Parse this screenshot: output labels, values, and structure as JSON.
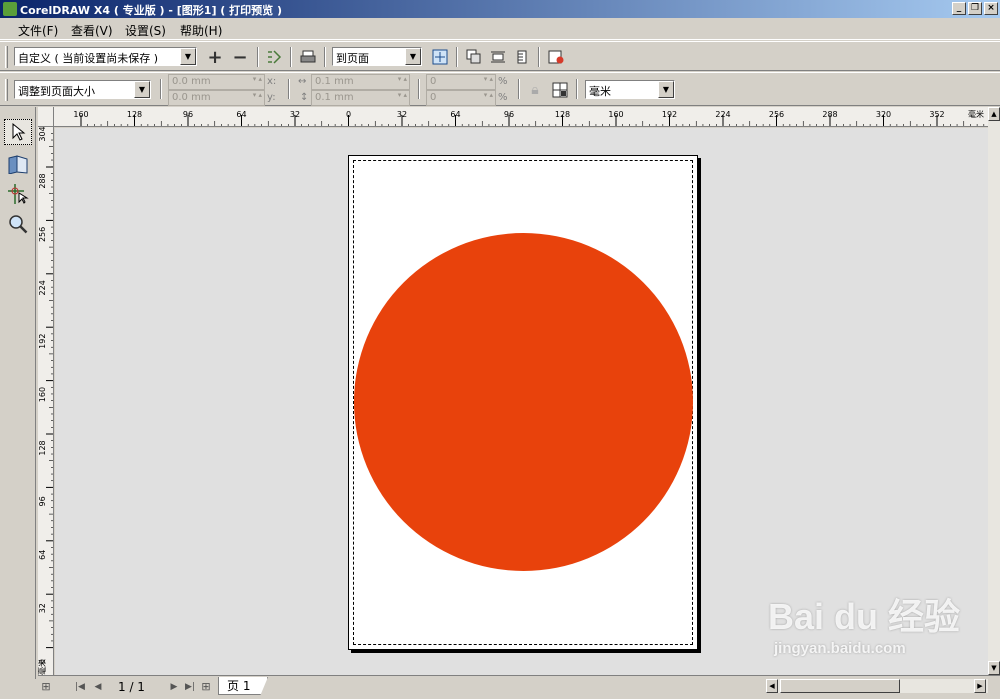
{
  "window": {
    "title": "CorelDRAW X4 ( 专业版 ) - [图形1] ( 打印预览 )"
  },
  "menu": [
    "文件(F)",
    "查看(V)",
    "设置(S)",
    "帮助(H)"
  ],
  "toolbar1": {
    "preset": "自定义 ( 当前设置尚未保存 )",
    "fit": "到页面"
  },
  "toolbar2": {
    "layout": "调整到页面大小",
    "x_top": "0.0 mm",
    "x_bottom": "0.0 mm",
    "x_label": "x:",
    "y_label": "y:",
    "w_top": "0.1 mm",
    "w_bottom": "0.1 mm",
    "pct_top": "0",
    "pct_bottom": "0",
    "pct_unit": "%",
    "units": "毫米"
  },
  "ruler": {
    "h_ticks": [
      "160",
      "128",
      "96",
      "64",
      "32",
      "0",
      "32",
      "64",
      "96",
      "128",
      "160",
      "192",
      "224",
      "256",
      "288",
      "320",
      "352"
    ],
    "h_unit": "毫米",
    "v_ticks": [
      "304",
      "288",
      "256",
      "224",
      "192",
      "160",
      "128",
      "96",
      "64",
      "32",
      "0"
    ],
    "v_unit": "毫米"
  },
  "page": {
    "circle_color": "#e8420c"
  },
  "footer": {
    "page_count": "1 / 1",
    "tab": "页 1"
  },
  "watermark": {
    "main": "Bai du 经验",
    "sub": "jingyan.baidu.com"
  },
  "colors": {
    "titlebar_start": "#0a246a",
    "chrome": "#d4d0c8",
    "canvas": "#e0e0e0"
  }
}
